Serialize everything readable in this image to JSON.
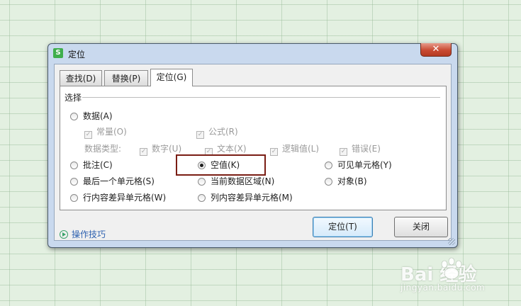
{
  "dialog": {
    "title": "定位",
    "app_icon_letter": "S",
    "close_glyph": "✕",
    "tabs": [
      {
        "label": "查找(D)",
        "active": false
      },
      {
        "label": "替换(P)",
        "active": false
      },
      {
        "label": "定位(G)",
        "active": true
      }
    ],
    "group_label": "选择",
    "options": {
      "data": {
        "label": "数据(A)",
        "selected": false
      },
      "constants": {
        "label": "常量(O)",
        "checked": true
      },
      "formulas": {
        "label": "公式(R)",
        "checked": true
      },
      "data_types_label": "数据类型:",
      "numbers": {
        "label": "数字(U)",
        "checked": true
      },
      "text": {
        "label": "文本(X)",
        "checked": true
      },
      "logicals": {
        "label": "逻辑值(L)",
        "checked": true
      },
      "errors": {
        "label": "错误(E)",
        "checked": true
      },
      "comments": {
        "label": "批注(C)",
        "selected": false
      },
      "blanks": {
        "label": "空值(K)",
        "selected": true
      },
      "visible_cells": {
        "label": "可见单元格(Y)",
        "selected": false
      },
      "last_cell": {
        "label": "最后一个单元格(S)",
        "selected": false
      },
      "current_region": {
        "label": "当前数据区域(N)",
        "selected": false
      },
      "objects": {
        "label": "对象(B)",
        "selected": false
      },
      "row_differences": {
        "label": "行内容差异单元格(W)",
        "selected": false
      },
      "column_differences": {
        "label": "列内容差异单元格(M)",
        "selected": false
      }
    },
    "tips_label": "操作技巧",
    "locate_button": "定位(T)",
    "close_button": "关闭"
  },
  "watermark": {
    "logo": "Bai  经验",
    "url": "jingyan.baidu.com"
  },
  "colors": {
    "background": "#e3f0e1",
    "dialog_frame": "#c9d9ee",
    "highlight_box": "#7a1d14",
    "close_button": "#c94a32",
    "link": "#2f62b0"
  }
}
